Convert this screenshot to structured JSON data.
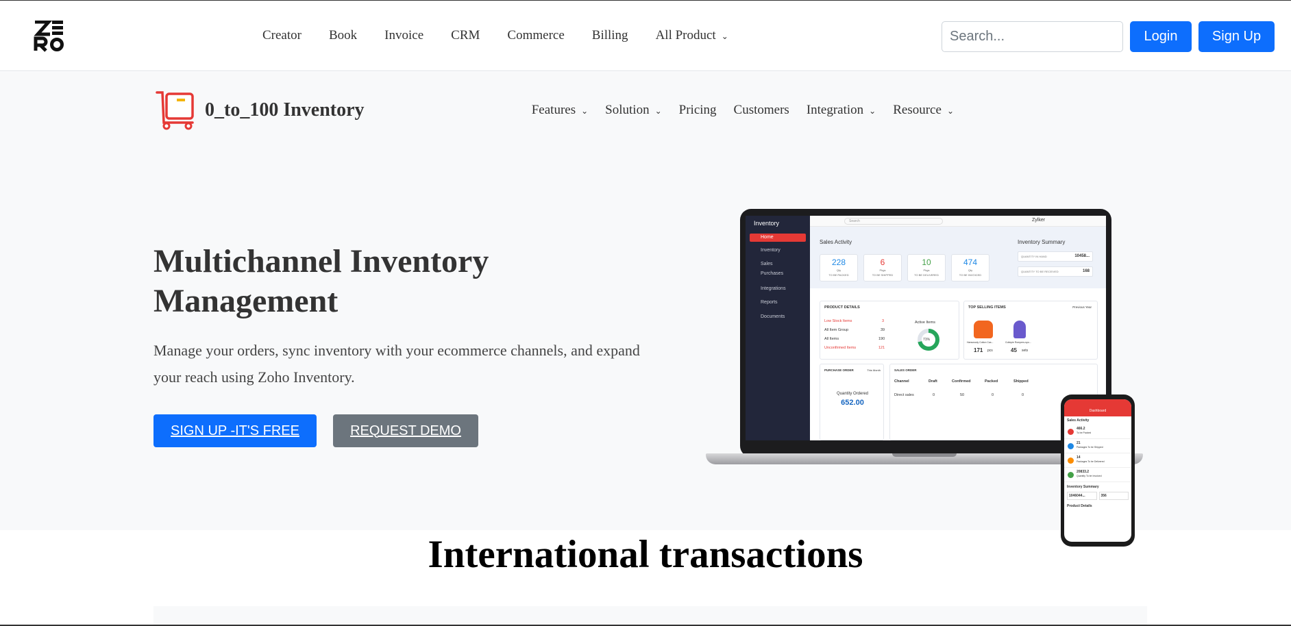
{
  "topbar": {
    "nav": [
      "Creator",
      "Book",
      "Invoice",
      "CRM",
      "Commerce",
      "Billing",
      "All Product"
    ],
    "search_placeholder": "Search...",
    "login": "Login",
    "signup": "Sign Up"
  },
  "product_nav": {
    "brand_name": "0_to_100 Inventory",
    "items": [
      "Features",
      "Solution",
      "Pricing",
      "Customers",
      "Integration",
      "Resource"
    ]
  },
  "hero": {
    "title": "Multichannel Inventory Management",
    "description": "Manage your orders, sync inventory with your ecommerce channels, and expand your reach using Zoho Inventory.",
    "cta_primary": "SIGN UP -IT'S FREE",
    "cta_secondary": "REQUEST DEMO"
  },
  "mockup": {
    "app_title": "Inventory",
    "search": "Search",
    "org": "Zylker",
    "sidebar": [
      "Home",
      "Inventory",
      "Sales",
      "Purchases",
      "Integrations",
      "Reports",
      "Documents"
    ],
    "sales_activity_title": "Sales Activity",
    "sales_cards": [
      {
        "value": "228",
        "unit": "Qty",
        "label": "TO BE PACKED",
        "color": "#1e88e5"
      },
      {
        "value": "6",
        "unit": "Pkgs",
        "label": "TO BE SHIPPED",
        "color": "#e53935"
      },
      {
        "value": "10",
        "unit": "Pkgs",
        "label": "TO BE DELIVERED",
        "color": "#43a047"
      },
      {
        "value": "474",
        "unit": "Qty",
        "label": "TO BE INVOICED",
        "color": "#1e88e5"
      }
    ],
    "inventory_summary_title": "Inventory Summary",
    "inventory_summary": [
      {
        "label": "QUANTITY IN HAND",
        "value": "10458..."
      },
      {
        "label": "QUANTITY TO BE RECEIVED",
        "value": "168"
      }
    ],
    "product_details_title": "PRODUCT DETAILS",
    "product_details": [
      {
        "label": "Low Stock Items",
        "value": "3"
      },
      {
        "label": "All Item Group",
        "value": "39"
      },
      {
        "label": "All Items",
        "value": "190"
      },
      {
        "label": "Unconfirmed Items",
        "value": "121"
      }
    ],
    "active_items_label": "Active Items",
    "active_items_pct": "71%",
    "top_selling_title": "TOP SELLING ITEMS",
    "top_selling_period": "Previous Year",
    "top_selling": [
      {
        "name": "Hanswooly Cotton Cas...",
        "qty": "171",
        "unit": "pcs"
      },
      {
        "name": "Cutiepie Rompers-spo...",
        "qty": "45",
        "unit": "sets"
      }
    ],
    "purchase_order_title": "PURCHASE ORDER",
    "purchase_period": "This Month",
    "quantity_ordered_label": "Quantity Ordered",
    "quantity_ordered_value": "652.00",
    "sales_order_title": "SALES ORDER",
    "sales_order_headers": [
      "Channel",
      "Draft",
      "Confirmed",
      "Packed",
      "Shipped"
    ],
    "sales_order_row": [
      "Direct sales",
      "0",
      "50",
      "0",
      "0"
    ],
    "phone": {
      "header": "Dashboard",
      "section": "Sales Activity",
      "rows": [
        {
          "value": "466.2",
          "label": "To be Packed",
          "color": "#e53935"
        },
        {
          "value": "21",
          "label": "Packages To be Shipped",
          "color": "#1e88e5"
        },
        {
          "value": "14",
          "label": "Packages To be Delivered",
          "color": "#fb8c00"
        },
        {
          "value": "20833.2",
          "label": "Quantity To be Invoiced",
          "color": "#43a047"
        }
      ],
      "summary_title": "Inventory Summary",
      "summary_hand": "1046044...",
      "summary_receive": "356",
      "details_title": "Product Details"
    }
  },
  "section": {
    "title": "International transactions"
  }
}
